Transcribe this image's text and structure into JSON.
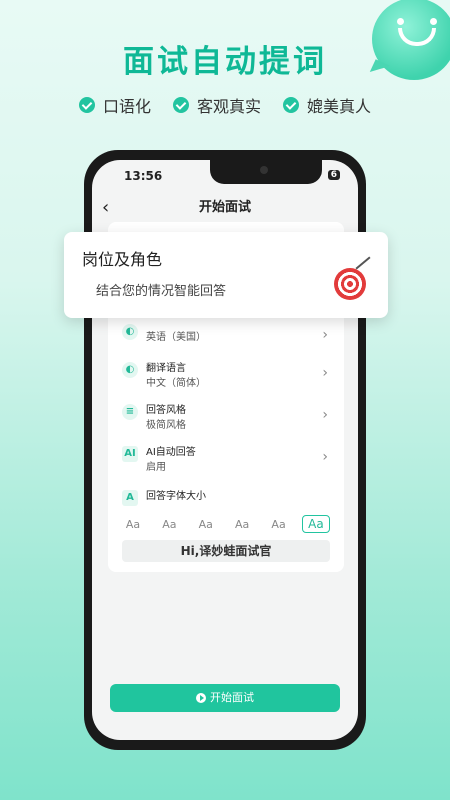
{
  "promo": {
    "headline": "面试自动提词",
    "features": [
      "口语化",
      "客观真实",
      "媲美真人"
    ]
  },
  "status_bar": {
    "time": "13:56",
    "battery": "6"
  },
  "nav": {
    "title": "开始面试"
  },
  "popup": {
    "title": "岗位及角色",
    "subtitle": "结合您的情况智能回答"
  },
  "settings": [
    {
      "title": "",
      "value": "英语（美国）"
    },
    {
      "title": "翻译语言",
      "value": "中文（简体）"
    },
    {
      "title": "回答风格",
      "value": "极简风格"
    },
    {
      "title": "AI自动回答",
      "value": "启用"
    }
  ],
  "font_size": {
    "label": "回答字体大小",
    "options": [
      "Aa",
      "Aa",
      "Aa",
      "Aa",
      "Aa",
      "Aa"
    ],
    "selected_index": 5,
    "preview": "Hi,译妙蛙面试官"
  },
  "start_button": {
    "label": "开始面试"
  },
  "colors": {
    "accent": "#20c59e",
    "headline": "#0fb896"
  }
}
